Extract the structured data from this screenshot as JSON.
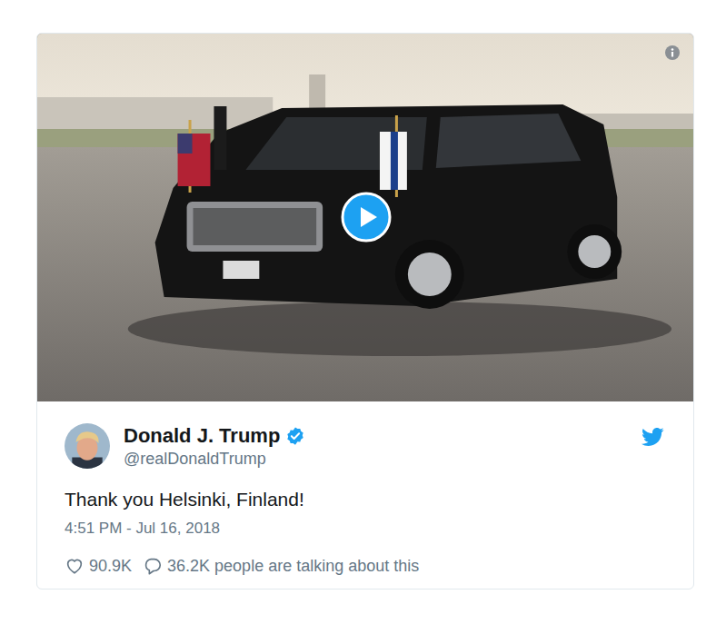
{
  "author": {
    "name": "Donald J. Trump",
    "handle": "@realDonaldTrump",
    "verified": true
  },
  "tweet": {
    "text": "Thank you Helsinki, Finland!",
    "timestamp": "4:51 PM - Jul 16, 2018"
  },
  "stats": {
    "likes": "90.9K",
    "replies": "36.2K people are talking about this"
  }
}
